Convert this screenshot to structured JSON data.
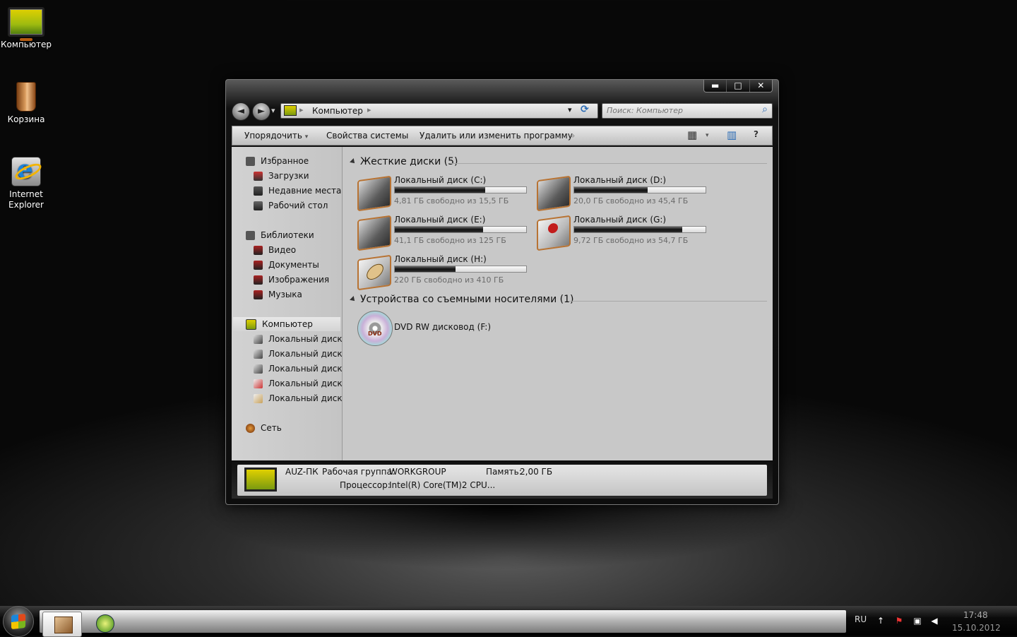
{
  "desktop": {
    "icons": [
      {
        "label": "Компьютер",
        "icon": "computer-icon"
      },
      {
        "label": "Корзина",
        "icon": "recycle-bin-icon"
      },
      {
        "label": "Internet Explorer",
        "icon": "internet-explorer-icon"
      }
    ]
  },
  "window": {
    "caption_buttons": {
      "minimize": "▬",
      "maximize": "□",
      "close": "✕"
    },
    "nav": {
      "back": "◄",
      "forward": "►",
      "history": "▾"
    },
    "address": {
      "crumb": "Компьютер",
      "sep": "▸",
      "dropdown": "▾",
      "refresh": "⟳"
    },
    "search": {
      "placeholder": "Поиск: Компьютер",
      "icon": "⌕"
    },
    "toolbar": {
      "organize": "Упорядочить",
      "caret": "▾",
      "system_properties": "Свойства системы",
      "uninstall": "Удалить или изменить программу",
      "more": "»",
      "view": "▦",
      "view_caret": "▾",
      "preview": "▥",
      "help": "?"
    },
    "navpane": {
      "favorites": "Избранное",
      "downloads": "Загрузки",
      "recent": "Недавние места",
      "desktop": "Рабочий стол",
      "libraries": "Библиотеки",
      "video": "Видео",
      "documents": "Документы",
      "images": "Изображения",
      "music": "Музыка",
      "computer": "Компьютер",
      "disk_c": "Локальный диск (C",
      "disk_d": "Локальный диск (D",
      "disk_e": "Локальный диск (E:",
      "disk_g": "Локальный диск (G",
      "disk_h": "Локальный диск (H",
      "network": "Сеть"
    },
    "groups": {
      "hard_disks": "Жесткие диски (5)",
      "removable": "Устройства со съемными носителями (1)"
    },
    "drives": [
      {
        "name": "Локальный диск (C:)",
        "free": "4,81 ГБ свободно из 15,5 ГБ",
        "used_fraction": 0.69
      },
      {
        "name": "Локальный диск (D:)",
        "free": "20,0 ГБ свободно из 45,4 ГБ",
        "used_fraction": 0.56
      },
      {
        "name": "Локальный диск (E:)",
        "free": "41,1 ГБ свободно из 125 ГБ",
        "used_fraction": 0.67
      },
      {
        "name": "Локальный диск (G:)",
        "free": "9,72 ГБ свободно из 54,7 ГБ",
        "used_fraction": 0.82
      },
      {
        "name": "Локальный диск (H:)",
        "free": "220 ГБ свободно из 410 ГБ",
        "used_fraction": 0.46
      }
    ],
    "dvd": {
      "name": "DVD RW дисковод (F:)",
      "label": "DVD"
    },
    "details": {
      "pc_name": "AUZ-ПК",
      "workgroup_label": "Рабочая группа:",
      "workgroup": "WORKGROUP",
      "memory_label": "Память:",
      "memory": "2,00 ГБ",
      "cpu_label": "Процессор:",
      "cpu": "Intel(R) Core(TM)2 CPU..."
    }
  },
  "taskbar": {
    "lang": "RU",
    "time": "17:48",
    "date": "15.10.2012",
    "tray_icons": [
      "up-arrow-icon",
      "action-center-icon",
      "network-icon",
      "volume-icon"
    ]
  }
}
